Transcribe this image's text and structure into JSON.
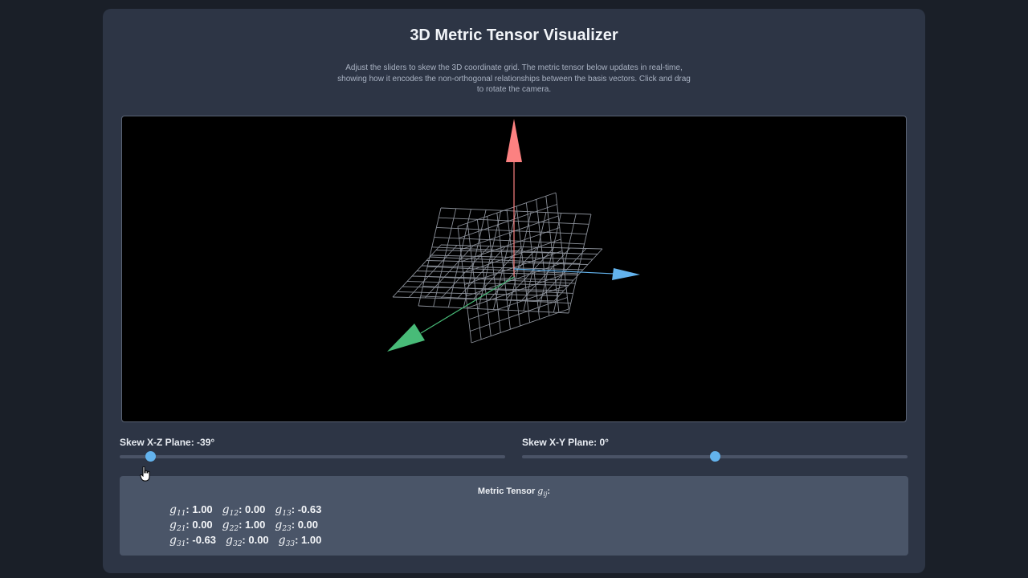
{
  "header": {
    "title": "3D Metric Tensor Visualizer",
    "description": "Adjust the sliders to skew the 3D coordinate grid. The metric tensor below updates in real-time, showing how it encodes the non-orthogonal relationships between the basis vectors. Click and drag to rotate the camera."
  },
  "viewport": {
    "axis_colors": {
      "vertical": "#fc8181",
      "right": "#63b3ed",
      "toward_viewer": "#48bb78"
    },
    "grid_color": "#8a8f98"
  },
  "sliders": {
    "xz": {
      "label": "Skew X-Z Plane: -39°",
      "value_fraction": 0.08
    },
    "xy": {
      "label": "Skew X-Y Plane: 0°",
      "value_fraction": 0.5
    }
  },
  "tensor": {
    "title": "Metric Tensor",
    "symbol": "g",
    "symbol_sub": "ij",
    "rows": [
      [
        {
          "sub": "11",
          "value": "1.00"
        },
        {
          "sub": "12",
          "value": "0.00"
        },
        {
          "sub": "13",
          "value": "-0.63"
        }
      ],
      [
        {
          "sub": "21",
          "value": "0.00"
        },
        {
          "sub": "22",
          "value": "1.00"
        },
        {
          "sub": "23",
          "value": "0.00"
        }
      ],
      [
        {
          "sub": "31",
          "value": "-0.63"
        },
        {
          "sub": "32",
          "value": "0.00"
        },
        {
          "sub": "33",
          "value": "1.00"
        }
      ]
    ]
  },
  "accent_color": "#63b3ed"
}
